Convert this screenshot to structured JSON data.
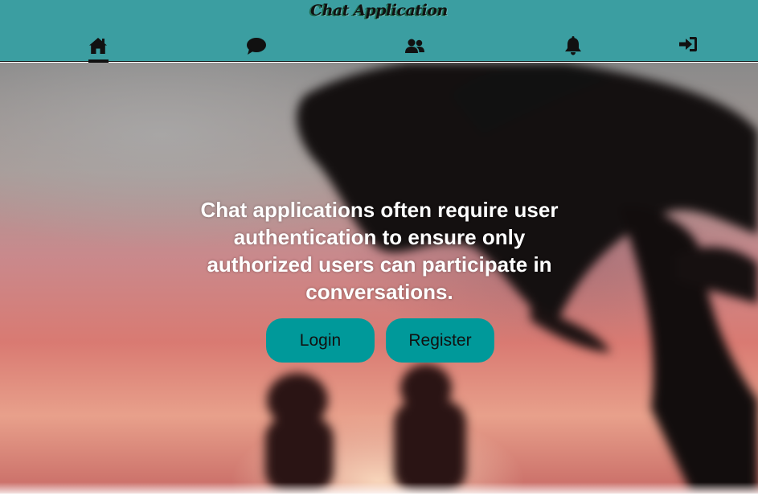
{
  "app": {
    "title": "Chat Application",
    "brand_color": "#3b9ea1",
    "button_color": "#00999a"
  },
  "nav": {
    "items": [
      {
        "name": "home",
        "icon": "home-icon",
        "active": true
      },
      {
        "name": "chat",
        "icon": "chat-bubble-icon",
        "active": false
      },
      {
        "name": "users",
        "icon": "users-icon",
        "active": false
      },
      {
        "name": "notifications",
        "icon": "bell-icon",
        "active": false
      },
      {
        "name": "login",
        "icon": "sign-in-icon",
        "active": false
      }
    ]
  },
  "hero": {
    "text": "Chat applications often require user authentication to ensure only authorized users can participate in conversations.",
    "login_label": "Login",
    "register_label": "Register"
  }
}
